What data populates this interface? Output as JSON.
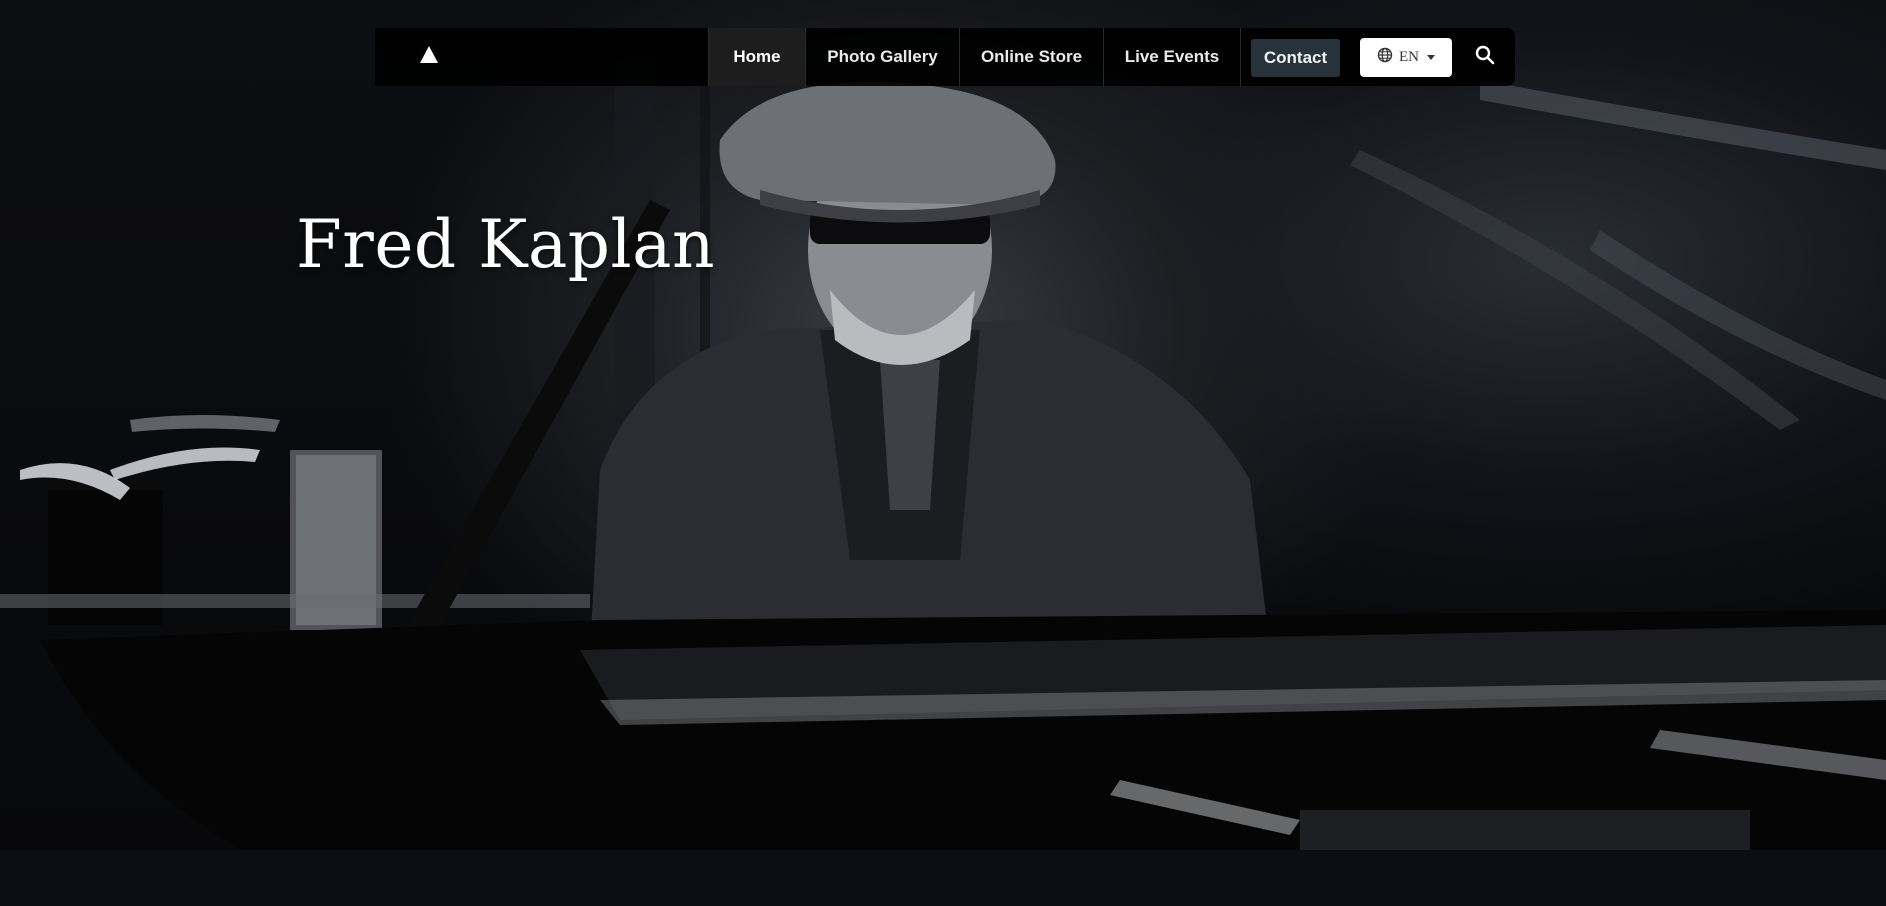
{
  "nav": {
    "logo_icon": "triangle-logo-icon",
    "items": [
      {
        "label": "Home",
        "active": true
      },
      {
        "label": "Photo Gallery",
        "active": false
      },
      {
        "label": "Online Store",
        "active": false
      },
      {
        "label": "Live Events",
        "active": false
      }
    ],
    "contact_label": "Contact",
    "language": {
      "icon": "globe-icon",
      "label": "EN"
    },
    "search_icon": "search-icon"
  },
  "hero": {
    "title": "Fred Kaplan"
  },
  "colors": {
    "navbar_bg": "#000000",
    "active_item_bg": "#1d1d1d",
    "contact_bg": "#28323a",
    "lang_bg": "#ffffff",
    "bottom_band": "#0b0f13"
  }
}
